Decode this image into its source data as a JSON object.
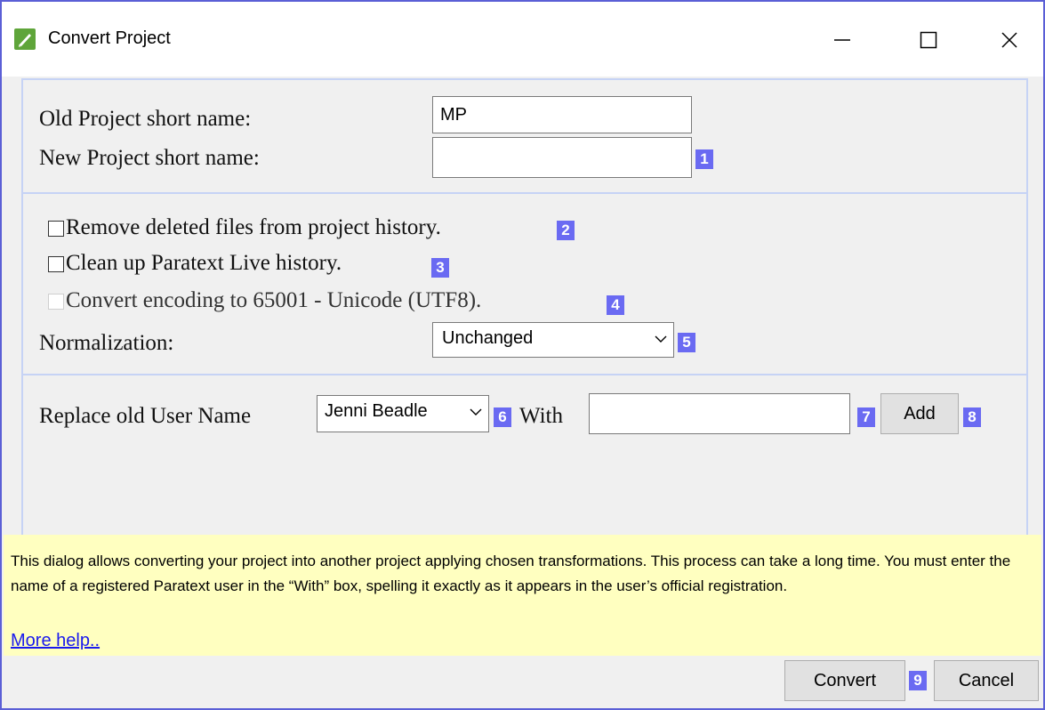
{
  "window": {
    "title": "Convert Project",
    "app_icon": "paratext-icon"
  },
  "project_names": {
    "old_label": "Old Project short name:",
    "old_value": "MP",
    "new_label": "New Project short name:",
    "new_value": "",
    "badge_new": "1"
  },
  "options": {
    "remove_deleted_label": "Remove deleted files from project history.",
    "remove_deleted_checked": false,
    "badge_remove": "2",
    "clean_live_label": "Clean up Paratext Live history.",
    "clean_live_checked": false,
    "badge_clean": "3",
    "convert_encoding_label": "Convert encoding to 65001 - Unicode (UTF8).",
    "convert_encoding_enabled": false,
    "badge_encoding": "4",
    "normalization_label": "Normalization:",
    "normalization_value": "Unchanged",
    "badge_normalization": "5"
  },
  "users": {
    "replace_label": "Replace old User Name",
    "old_user_value": "Jenni Beadle",
    "badge_old_user": "6",
    "with_label": "With",
    "new_user_value": "",
    "badge_new_user": "7",
    "add_label": "Add",
    "badge_add": "8"
  },
  "help": {
    "text": "This dialog allows converting your project into another project applying chosen transformations. This process can take a long time. You must enter the name of a registered Paratext user in the “With” box, spelling it exactly as it appears in the user’s official registration.",
    "more_help": "More help.."
  },
  "footer": {
    "convert_label": "Convert",
    "badge_convert": "9",
    "cancel_label": "Cancel"
  },
  "colors": {
    "badge": "#6a6af2",
    "help_background": "#ffffc0",
    "window_border": "#5b5fd6",
    "panel_border": "#c6d3f5"
  }
}
